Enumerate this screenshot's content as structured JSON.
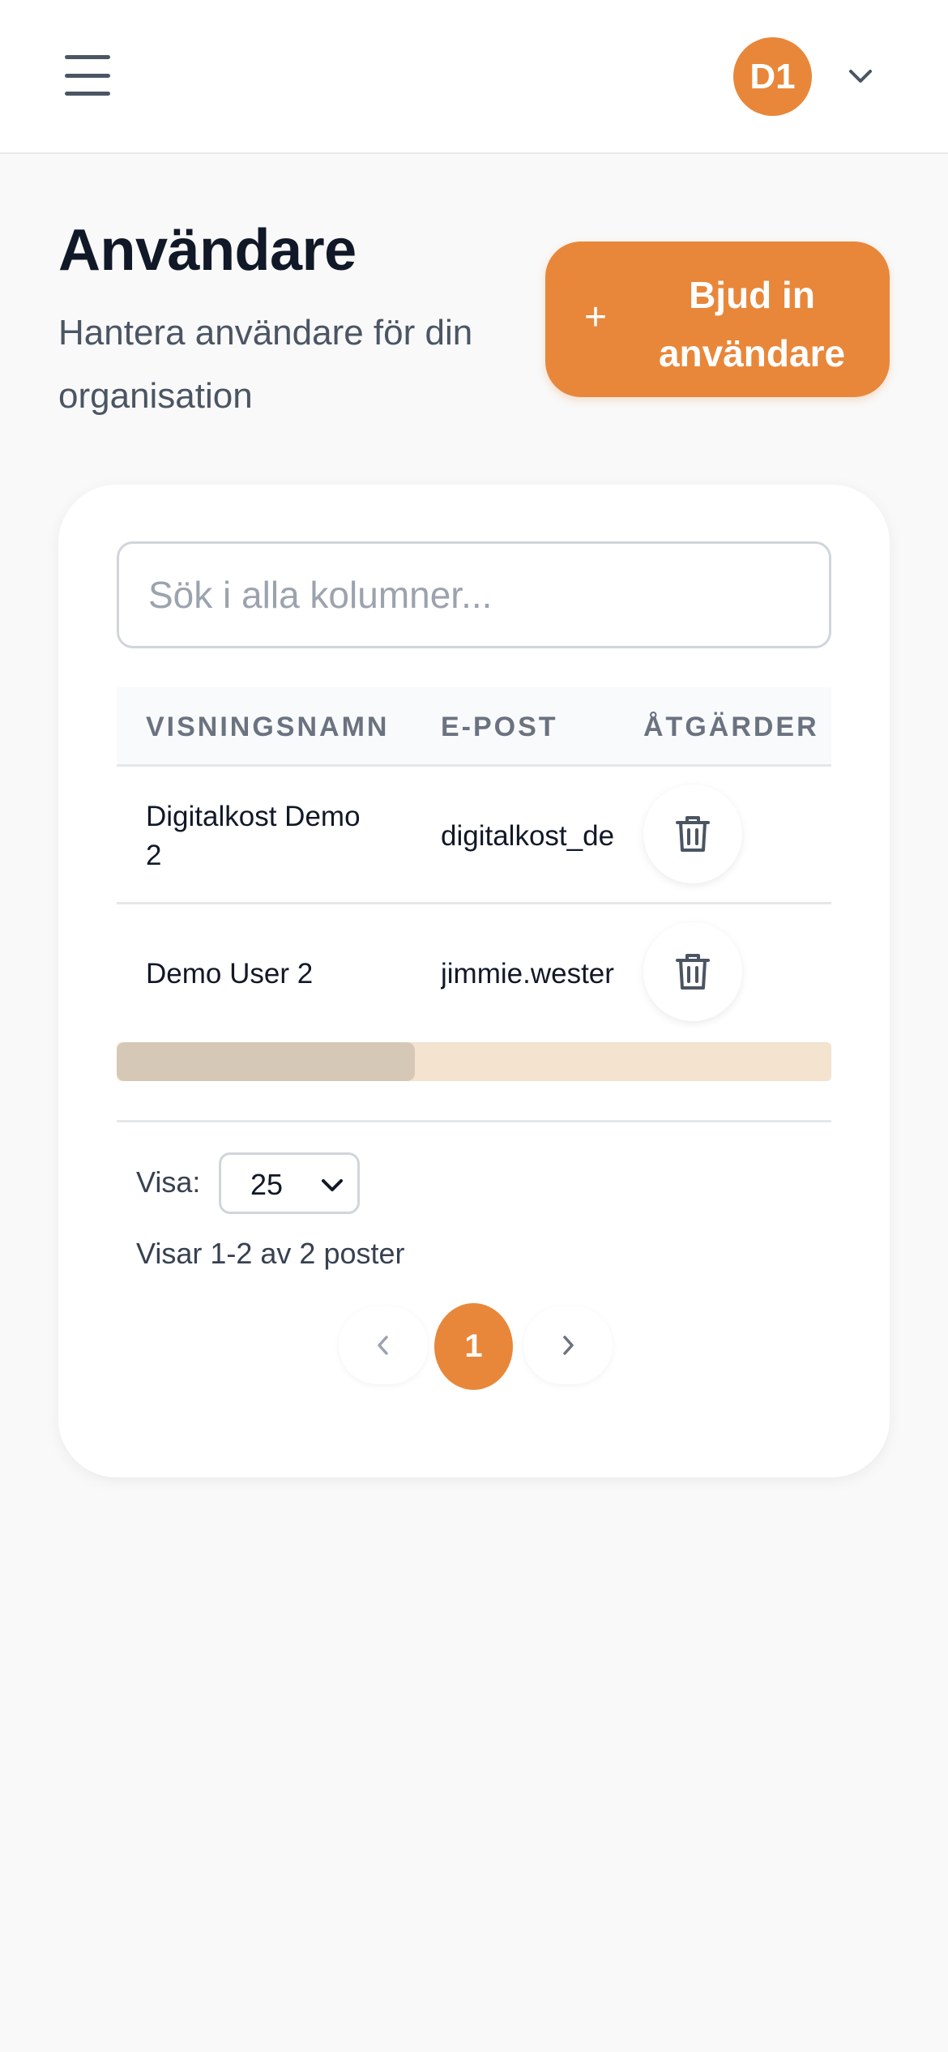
{
  "header": {
    "avatar_initials": "D1"
  },
  "page": {
    "title": "Användare",
    "subtitle": "Hantera användare för din organisation",
    "invite_button": {
      "icon": "plus",
      "label": "Bjud in användare"
    }
  },
  "search": {
    "placeholder": "Sök i alla kolumner...",
    "value": ""
  },
  "table": {
    "columns": [
      "VISNINGSNAMN",
      "E-POST",
      "ÅTGÄRDER"
    ],
    "rows": [
      {
        "name": "Digitalkost Demo 2",
        "email": "digitalkost_demo",
        "action_icon": "trash-icon"
      },
      {
        "name": "Demo User 2",
        "email": "jimmie.westerberg",
        "action_icon": "trash-icon"
      }
    ]
  },
  "footer": {
    "page_size_label": "Visa:",
    "page_size_value": "25",
    "records_text": "Visar 1-2 av 2 poster",
    "current_page": "1"
  },
  "colors": {
    "accent": "#e8873a",
    "background": "#f9f9f9",
    "card": "#ffffff",
    "text": "#111827",
    "muted": "#6b7280"
  }
}
